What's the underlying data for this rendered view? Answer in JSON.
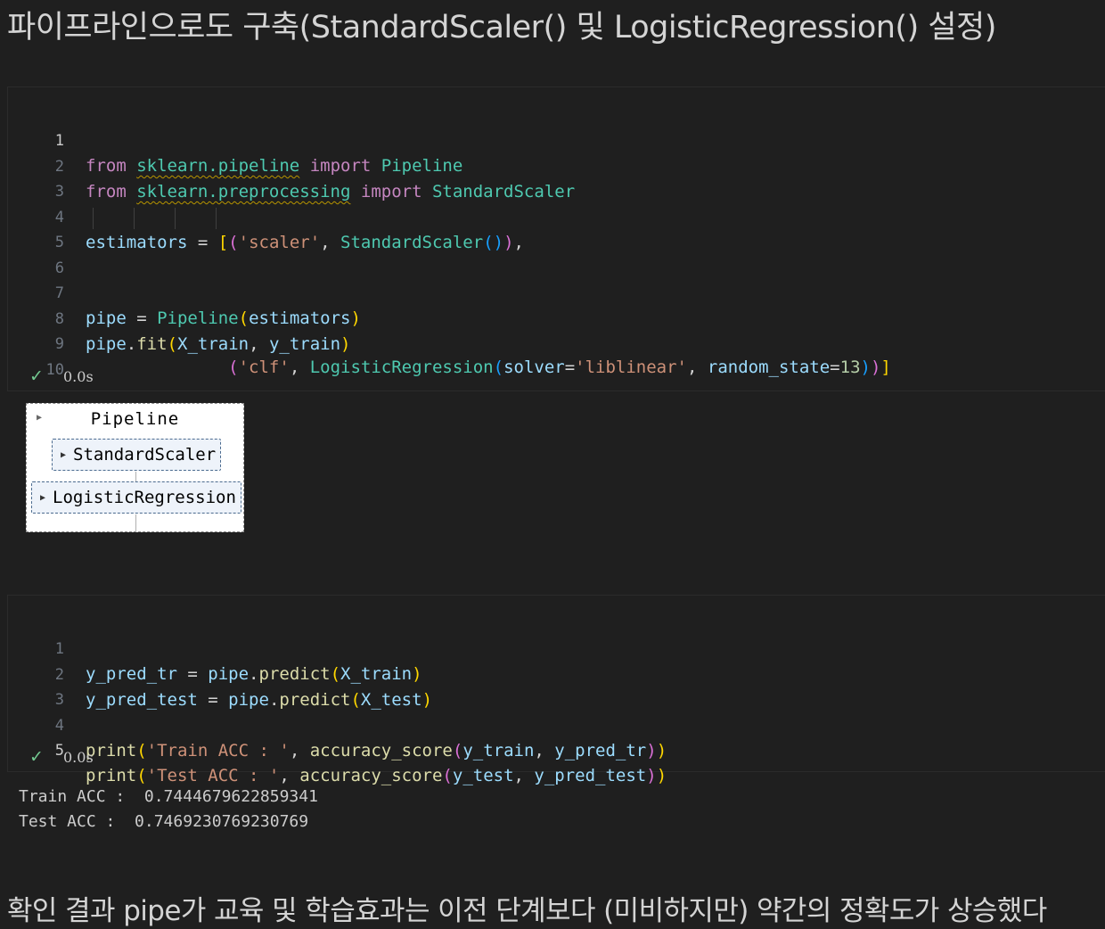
{
  "heading": "파이프라인으로도 구축(StandardScaler() 및 LogisticRegression() 설정)",
  "cell1": {
    "line_numbers": [
      "1",
      "2",
      "3",
      "4",
      "5",
      "6",
      "7",
      "8",
      "9",
      "10"
    ],
    "tokens": {
      "from": "from",
      "import": "import",
      "mod_pipeline": "sklearn.pipeline",
      "mod_preprocessing": "sklearn.preprocessing",
      "Pipeline": "Pipeline",
      "StandardScaler": "StandardScaler",
      "LogisticRegression": "LogisticRegression",
      "estimators": "estimators",
      "str_scaler": "'scaler'",
      "str_clf": "'clf'",
      "solver": "solver",
      "str_liblinear": "'liblinear'",
      "random_state": "random_state",
      "num_13": "13",
      "pipe": "pipe",
      "fit": "fit",
      "X_train": "X_train",
      "y_train": "y_train"
    },
    "status": {
      "check": "✓",
      "time": "0.0s"
    }
  },
  "diagram": {
    "title": "Pipeline",
    "steps": [
      "StandardScaler",
      "LogisticRegression"
    ]
  },
  "cell2": {
    "line_numbers": [
      "1",
      "2",
      "3",
      "4",
      "5"
    ],
    "tokens": {
      "y_pred_tr": "y_pred_tr",
      "y_pred_test": "y_pred_test",
      "pipe": "pipe",
      "predict": "predict",
      "X_train": "X_train",
      "X_test": "X_test",
      "print": "print",
      "str_train": "'Train ACC : '",
      "str_test": "'Test ACC : '",
      "accuracy_score": "accuracy_score",
      "y_train": "y_train",
      "y_test": "y_test"
    },
    "status": {
      "check": "✓",
      "time": "0.0s"
    }
  },
  "output": [
    "Train ACC :  0.7444679622859341",
    "Test ACC :  0.7469230769230769"
  ],
  "summary": "확인 결과 pipe가 교육 및 학습효과는 이전 단계보다 (미비하지만) 약간의 정확도가 상승했다"
}
